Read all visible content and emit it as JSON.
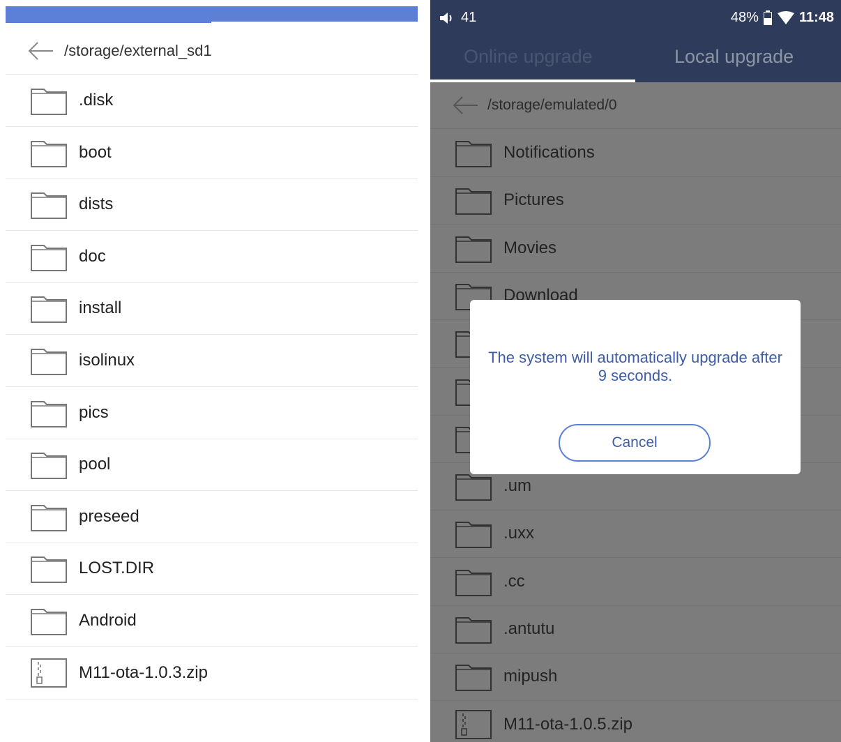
{
  "left": {
    "path": "/storage/external_sd1",
    "items": [
      {
        "name": ".disk",
        "type": "folder"
      },
      {
        "name": "boot",
        "type": "folder"
      },
      {
        "name": "dists",
        "type": "folder"
      },
      {
        "name": "doc",
        "type": "folder"
      },
      {
        "name": "install",
        "type": "folder"
      },
      {
        "name": "isolinux",
        "type": "folder"
      },
      {
        "name": "pics",
        "type": "folder"
      },
      {
        "name": "pool",
        "type": "folder"
      },
      {
        "name": "preseed",
        "type": "folder"
      },
      {
        "name": "LOST.DIR",
        "type": "folder"
      },
      {
        "name": "Android",
        "type": "folder"
      },
      {
        "name": "M11-ota-1.0.3.zip",
        "type": "zip"
      }
    ]
  },
  "right": {
    "status": {
      "volume": "41",
      "battery": "48%",
      "time": "11:48"
    },
    "tabs": [
      "Online upgrade",
      "Local upgrade"
    ],
    "path": "/storage/emulated/0",
    "items": [
      {
        "name": "Notifications",
        "type": "folder"
      },
      {
        "name": "Pictures",
        "type": "folder"
      },
      {
        "name": "Movies",
        "type": "folder"
      },
      {
        "name": "Download",
        "type": "folder"
      },
      {
        "name": "",
        "type": "folder"
      },
      {
        "name": "",
        "type": "folder"
      },
      {
        "name": "",
        "type": "folder"
      },
      {
        "name": ".um",
        "type": "folder"
      },
      {
        "name": ".uxx",
        "type": "folder"
      },
      {
        "name": ".cc",
        "type": "folder"
      },
      {
        "name": ".antutu",
        "type": "folder"
      },
      {
        "name": "mipush",
        "type": "folder"
      },
      {
        "name": "M11-ota-1.0.5.zip",
        "type": "zip"
      }
    ],
    "dialog": {
      "message": "The system will automatically upgrade after 9 seconds.",
      "cancel_label": "Cancel"
    }
  },
  "colors": {
    "accent": "#5b80d6",
    "header": "#2e3b5a",
    "dialog_text": "#3c5ca8"
  }
}
